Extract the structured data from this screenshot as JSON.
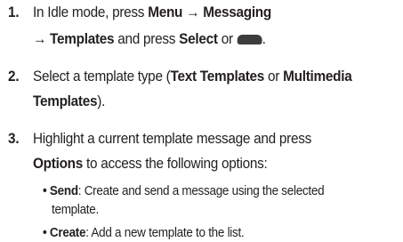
{
  "steps": [
    {
      "number": "1.",
      "line1": {
        "t1": "In Idle mode, press ",
        "b1": "Menu",
        "arrow1": " → ",
        "b2": "Messaging"
      },
      "line2": {
        "arrow2": "→ ",
        "b3": "Templates",
        "t2": " and press ",
        "b4": "Select",
        "t3": " or ",
        "key_icon": "softkey-icon",
        "t4": "."
      }
    },
    {
      "number": "2.",
      "line1": {
        "t1": "Select a template type (",
        "b1": "Text Templates",
        "t2": " or ",
        "b2": "Multimedia"
      },
      "line2": {
        "b3": "Templates",
        "t3": ")."
      }
    },
    {
      "number": "3.",
      "line1": {
        "t1": "Highlight a current template message and press"
      },
      "line2": {
        "b1": "Options",
        "t2": " to access the following options:"
      },
      "bullets": [
        {
          "bullet": "• ",
          "term": "Send",
          "desc_line1": ": Create and send a message using the selected",
          "desc_line2": "template."
        },
        {
          "bullet": "• ",
          "term": "Create",
          "desc_line1": ": Add a new template to the list."
        }
      ]
    }
  ]
}
